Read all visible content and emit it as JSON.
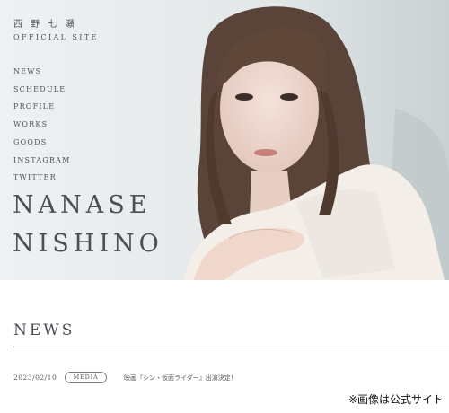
{
  "header": {
    "site_name": "西 野 七 瀬",
    "site_subtitle": "OFFICIAL SITE"
  },
  "nav": {
    "items": [
      "NEWS",
      "SCHEDULE",
      "PROFILE",
      "WORKS",
      "GOODS",
      "INSTAGRAM",
      "TWITTER"
    ]
  },
  "hero": {
    "name_first": "NANASE",
    "name_last": "NISHINO",
    "image": "portrait-photo"
  },
  "news": {
    "title": "NEWS",
    "items": [
      {
        "date": "2023/02/10",
        "category": "MEDIA",
        "text": "映画『シン・仮面ライダー』出演決定！"
      }
    ]
  },
  "caption": "※画像は公式サイト",
  "colors": {
    "text": "#4a4f55",
    "background": "#ffffff",
    "hero_bg": "#e9edee"
  }
}
